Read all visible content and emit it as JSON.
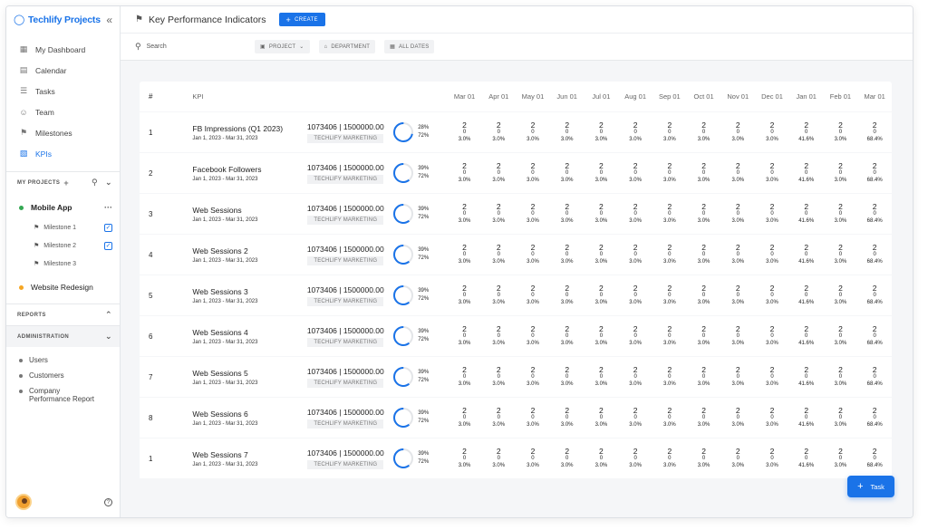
{
  "app": {
    "name": "Techlify Projects"
  },
  "nav": [
    {
      "label": "My Dashboard",
      "icon": "grid-icon",
      "active": false
    },
    {
      "label": "Calendar",
      "icon": "calendar-icon",
      "active": false
    },
    {
      "label": "Tasks",
      "icon": "tasks-icon",
      "active": false
    },
    {
      "label": "Team",
      "icon": "team-icon",
      "active": false
    },
    {
      "label": "Milestones",
      "icon": "flag-icon",
      "active": false
    },
    {
      "label": "KPIs",
      "icon": "chart-icon",
      "active": true
    }
  ],
  "projects": {
    "heading": "MY PROJECTS",
    "items": [
      {
        "label": "Mobile App",
        "color": "#34a853"
      },
      {
        "label": "Website Redesign",
        "color": "#f5a623"
      }
    ],
    "milestones": [
      "Milestone 1",
      "Milestone 2",
      "Milestone 3"
    ]
  },
  "reports": {
    "heading": "REPORTS"
  },
  "administration": {
    "heading": "ADMINISTRATION",
    "items": [
      "Users",
      "Customers",
      "Company Performance Report"
    ]
  },
  "header": {
    "title": "Key Performance Indicators",
    "create_label": "CREATE"
  },
  "filters": {
    "search_label": "Search",
    "project_label": "PROJECT",
    "department_label": "DEPARTMENT",
    "dates_label": "ALL DATES"
  },
  "table": {
    "col_num": "#",
    "col_kpi": "KPI",
    "months": [
      "Mar 01",
      "Apr 01",
      "May 01",
      "Jun 01",
      "Jul 01",
      "Aug 01",
      "Sep 01",
      "Oct 01",
      "Nov 01",
      "Dec 01",
      "Jan 01",
      "Feb 01",
      "Mar 01"
    ],
    "rows": [
      {
        "num": "1",
        "name": "FB Impressions (Q1 2023)",
        "dates": "Jan 1, 2023 - Mar 31, 2023",
        "value": "1073406 | 1500000.00",
        "dept": "TECHLIFY MARKETING",
        "pct_a": "28%",
        "pct_b": "72%",
        "progress": 0.28
      },
      {
        "num": "2",
        "name": "Facebook Followers",
        "dates": "Jan 1, 2023 - Mar 31, 2023",
        "value": "1073406 | 1500000.00",
        "dept": "TECHLIFY MARKETING",
        "pct_a": "39%",
        "pct_b": "72%",
        "progress": 0.39
      },
      {
        "num": "3",
        "name": "Web Sessions",
        "dates": "Jan 1, 2023 - Mar 31, 2023",
        "value": "1073406 | 1500000.00",
        "dept": "TECHLIFY MARKETING",
        "pct_a": "39%",
        "pct_b": "72%",
        "progress": 0.39
      },
      {
        "num": "4",
        "name": "Web Sessions 2",
        "dates": "Jan 1, 2023 - Mar 31, 2023",
        "value": "1073406 | 1500000.00",
        "dept": "TECHLIFY MARKETING",
        "pct_a": "39%",
        "pct_b": "72%",
        "progress": 0.39
      },
      {
        "num": "5",
        "name": "Web Sessions 3",
        "dates": "Jan 1, 2023 - Mar 31, 2023",
        "value": "1073406 | 1500000.00",
        "dept": "TECHLIFY MARKETING",
        "pct_a": "39%",
        "pct_b": "72%",
        "progress": 0.39
      },
      {
        "num": "6",
        "name": "Web Sessions 4",
        "dates": "Jan 1, 2023 - Mar 31, 2023",
        "value": "1073406 | 1500000.00",
        "dept": "TECHLIFY MARKETING",
        "pct_a": "39%",
        "pct_b": "72%",
        "progress": 0.39
      },
      {
        "num": "7",
        "name": "Web Sessions 5",
        "dates": "Jan 1, 2023 - Mar 31, 2023",
        "value": "1073406 | 1500000.00",
        "dept": "TECHLIFY MARKETING",
        "pct_a": "39%",
        "pct_b": "72%",
        "progress": 0.39
      },
      {
        "num": "8",
        "name": "Web Sessions 6",
        "dates": "Jan 1, 2023 - Mar 31, 2023",
        "value": "1073406 | 1500000.00",
        "dept": "TECHLIFY MARKETING",
        "pct_a": "39%",
        "pct_b": "72%",
        "progress": 0.39
      },
      {
        "num": "1",
        "name": "Web Sessions 7",
        "dates": "Jan 1, 2023 - Mar 31, 2023",
        "value": "1073406 | 1500000.00",
        "dept": "TECHLIFY MARKETING",
        "pct_a": "39%",
        "pct_b": "72%",
        "progress": 0.39
      }
    ],
    "cells": [
      {
        "top": "2",
        "mid": "0",
        "bot": "3.0%"
      },
      {
        "top": "2",
        "mid": "0",
        "bot": "3.0%"
      },
      {
        "top": "2",
        "mid": "0",
        "bot": "3.0%"
      },
      {
        "top": "2",
        "mid": "0",
        "bot": "3.0%"
      },
      {
        "top": "2",
        "mid": "0",
        "bot": "3.0%"
      },
      {
        "top": "2",
        "mid": "0",
        "bot": "3.0%"
      },
      {
        "top": "2",
        "mid": "0",
        "bot": "3.0%"
      },
      {
        "top": "2",
        "mid": "0",
        "bot": "3.0%"
      },
      {
        "top": "2",
        "mid": "0",
        "bot": "3.0%"
      },
      {
        "top": "2",
        "mid": "0",
        "bot": "3.0%"
      },
      {
        "top": "2",
        "mid": "0",
        "bot": "41.6%"
      },
      {
        "top": "2",
        "mid": "0",
        "bot": "3.0%"
      },
      {
        "top": "2",
        "mid": "0",
        "bot": "68.4%"
      }
    ]
  },
  "fab": {
    "label": "Task"
  },
  "colors": {
    "accent": "#1a73e8",
    "ring_track": "#e3e5e8"
  }
}
